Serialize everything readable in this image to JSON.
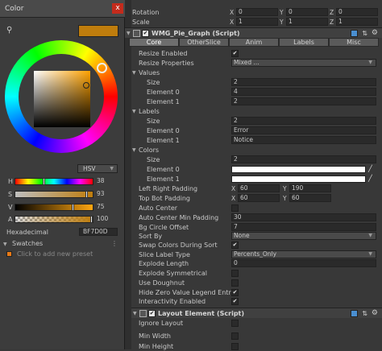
{
  "color_window": {
    "title": "Color",
    "close": "x",
    "mode": "HSV",
    "channels": [
      {
        "label": "H",
        "value": "38",
        "fill": 0.38
      },
      {
        "label": "S",
        "value": "93",
        "fill": 0.93
      },
      {
        "label": "V",
        "value": "75",
        "fill": 0.75
      },
      {
        "label": "A",
        "value": "100",
        "fill": 1.0
      }
    ],
    "hex_label": "Hexadecimal",
    "hex_value": "BF7D0D",
    "swatches_label": "Swatches",
    "add_preset": "Click to add new preset",
    "current_color": "#BF7D0D"
  },
  "transform": {
    "rotation_label": "Rotation",
    "scale_label": "Scale",
    "rotation": {
      "x": "0",
      "y": "0",
      "z": "0"
    },
    "scale": {
      "x": "1",
      "y": "1",
      "z": "1"
    }
  },
  "pie_component": {
    "title": "WMG_Pie_Graph (Script)",
    "tabs": [
      "Core",
      "OtherSlice",
      "Anim",
      "Labels",
      "Misc"
    ]
  },
  "props": {
    "resize_enabled": "Resize Enabled",
    "resize_properties": "Resize Properties",
    "resize_properties_value": "Mixed ...",
    "values": "Values",
    "size": "Size",
    "values_size": "2",
    "element0": "Element 0",
    "element1": "Element 1",
    "values_e0": "4",
    "values_e1": "2",
    "labels": "Labels",
    "labels_size": "2",
    "labels_e0": "Error",
    "labels_e1": "Notice",
    "colors": "Colors",
    "colors_size": "2",
    "left_right_padding": "Left Right Padding",
    "lrp_x": "60",
    "lrp_y": "190",
    "top_bot_padding": "Top Bot Padding",
    "tbp_x": "60",
    "tbp_y": "60",
    "auto_center": "Auto Center",
    "auto_center_min_padding": "Auto Center Min Padding",
    "acmp_value": "30",
    "bg_circle_offset": "Bg Circle Offset",
    "bco_value": "7",
    "sort_by": "Sort By",
    "sort_by_value": "None",
    "swap_colors": "Swap Colors During Sort",
    "slice_label_type": "Slice Label Type",
    "slice_label_type_value": "Percents_Only",
    "explode_length": "Explode Length",
    "explode_length_value": "0",
    "explode_symmetrical": "Explode Symmetrical",
    "use_doughnut": "Use Doughnut",
    "hide_zero": "Hide Zero Value Legend Entry",
    "interactivity": "Interactivity Enabled"
  },
  "layout_component": {
    "title": "Layout Element (Script)",
    "ignore_layout": "Ignore Layout",
    "min_width": "Min Width",
    "min_height": "Min Height"
  },
  "axis": {
    "x": "X",
    "y": "Y",
    "z": "Z"
  },
  "check": "✔"
}
